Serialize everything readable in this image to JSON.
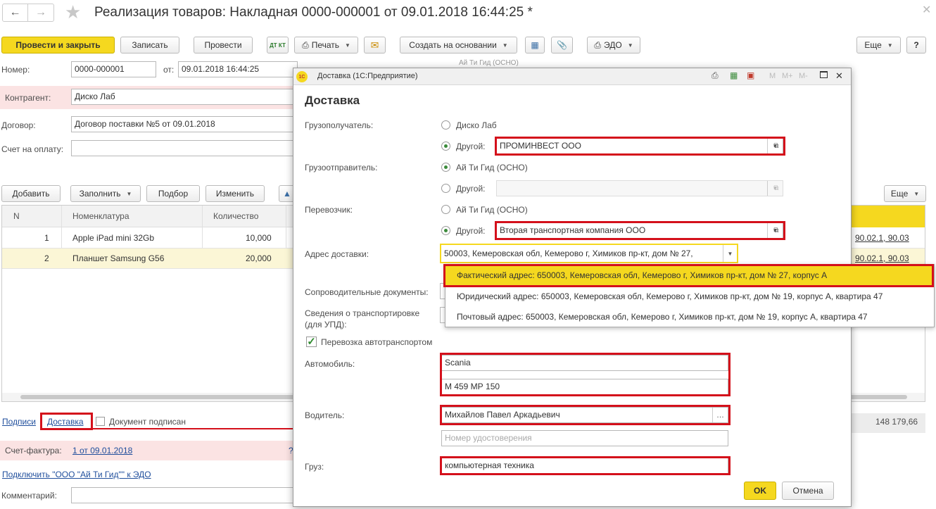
{
  "window": {
    "title": "Реализация товаров: Накладная 0000-000001 от 09.01.2018 16:44:25 *"
  },
  "toolbar": {
    "post_close": "Провести и закрыть",
    "save": "Записать",
    "post": "Провести",
    "dtkt": "ДТ КТ",
    "print": "Печать",
    "create_based": "Создать на основании",
    "edo": "ЭДО",
    "more": "Еще",
    "help": "?"
  },
  "header": {
    "number_label": "Номер:",
    "number_value": "0000-000001",
    "date_label": "от:",
    "date_value": "09.01.2018 16:44:25",
    "org_value": "Ай Ти Гид (ОСНО)",
    "counterparty_label": "Контрагент:",
    "counterparty_value": "Диско Лаб",
    "contract_label": "Договор:",
    "contract_value": "Договор поставки №5 от 09.01.2018",
    "invoice_label": "Счет на оплату:"
  },
  "table_toolbar": {
    "add": "Добавить",
    "fill": "Заполнить",
    "select": "Подбор",
    "change": "Изменить",
    "more": "Еще"
  },
  "table": {
    "columns": [
      "N",
      "Номенклатура",
      "Количество"
    ],
    "rows": [
      {
        "n": "1",
        "item": "Apple iPad mini 32Gb",
        "qty": "10,000",
        "accounts": "90.02.1, 90.03"
      },
      {
        "n": "2",
        "item": "Планшет Samsung G56",
        "qty": "20,000",
        "accounts": "90.02.1, 90.03"
      }
    ]
  },
  "footer": {
    "signatures": "Подписи",
    "delivery": "Доставка",
    "doc_signed": "Документ подписан",
    "total": "148 179,66",
    "invoice_label": "Счет-фактура:",
    "invoice_link": "1 от 09.01.2018",
    "invoice_help": "?",
    "edo_link": "Подключить \"ООО \"Ай Ти Гид\"\" к ЭДО",
    "comment_label": "Комментарий:"
  },
  "dialog": {
    "titlebar": "Доставка (1С:Предприятие)",
    "heading": "Доставка",
    "tb_m": "M",
    "tb_mplus": "M+",
    "tb_mminus": "M-",
    "consignee_label": "Грузополучатель:",
    "consignee_opt1": "Диско Лаб",
    "consignee_opt2": "Другой:",
    "consignee_value": "ПРОМИНВЕСТ ООО",
    "shipper_label": "Грузоотправитель:",
    "shipper_opt1": "Ай Ти Гид (ОСНО)",
    "shipper_opt2": "Другой:",
    "carrier_label": "Перевозчик:",
    "carrier_opt1": "Ай Ти Гид (ОСНО)",
    "carrier_opt2": "Другой:",
    "carrier_value": "Вторая транспортная компания ООО",
    "address_label": "Адрес доставки:",
    "address_value": "50003, Кемеровская обл, Кемерово г, Химиков пр-кт, дом № 27, ",
    "address_options": [
      "Фактический адрес: 650003, Кемеровская обл, Кемерово г, Химиков пр-кт, дом № 27, корпус А",
      "Юридический адрес: 650003, Кемеровская обл, Кемерово г, Химиков пр-кт, дом № 19, корпус А, квартира 47",
      "Почтовый адрес: 650003, Кемеровская обл, Кемерово г, Химиков пр-кт, дом № 19, корпус А, квартира 47"
    ],
    "docs_label": "Сопроводительные документы:",
    "transport_info_label1": "Сведения о транспортировке",
    "transport_info_label2": "(для УПД):",
    "motor_transport": "Перевозка автотранспортом",
    "vehicle_label": "Автомобиль:",
    "vehicle_value": "Scania",
    "vehicle_plate": "М 459 МР 150",
    "driver_label": "Водитель:",
    "driver_value": "Михайлов Павел Аркадьевич",
    "license_placeholder": "Номер удостоверения",
    "cargo_label": "Груз:",
    "cargo_value": "компьютерная техника",
    "ok": "OK",
    "cancel": "Отмена"
  },
  "colors": {
    "accent_yellow": "#f5d81f",
    "highlight_red": "#d4101b",
    "link_blue": "#1f4e9c",
    "row_selected": "#fbf6d6"
  }
}
